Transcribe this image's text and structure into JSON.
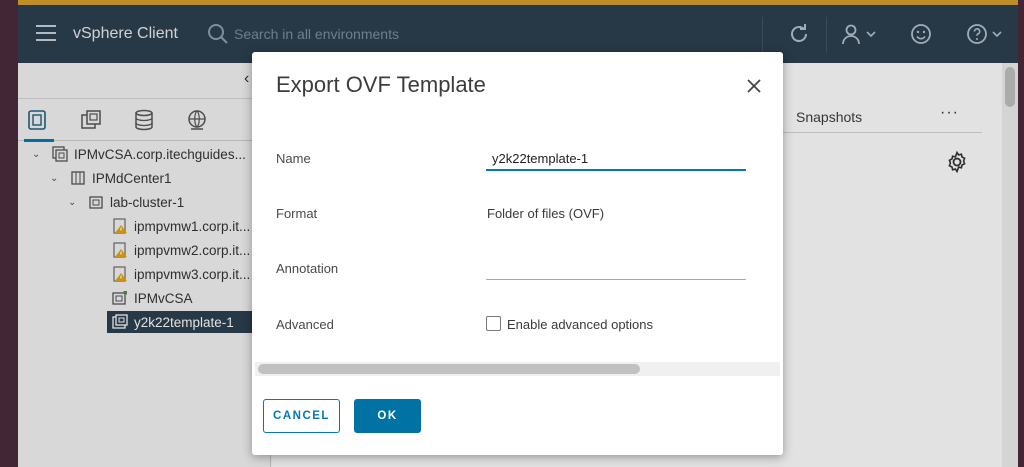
{
  "header": {
    "brand": "vSphere Client",
    "search_placeholder": "Search in all environments"
  },
  "tree": [
    {
      "label": "IPMvCSA.corp.itechguides...",
      "icon": "vcenter-icon",
      "expanded": true
    },
    {
      "label": "IPMdCenter1",
      "icon": "datacenter-icon",
      "expanded": true
    },
    {
      "label": "lab-cluster-1",
      "icon": "cluster-icon",
      "expanded": true
    },
    {
      "label": "ipmpvmw1.corp.it...",
      "icon": "host-warning-icon"
    },
    {
      "label": "ipmpvmw2.corp.it...",
      "icon": "host-warning-icon"
    },
    {
      "label": "ipmpvmw3.corp.it...",
      "icon": "host-warning-icon"
    },
    {
      "label": "IPMvCSA",
      "icon": "vm-icon"
    },
    {
      "label": "y2k22template-1",
      "icon": "template-icon",
      "selected": true
    }
  ],
  "content": {
    "tab_snapshots": "Snapshots",
    "more": "···"
  },
  "dialog": {
    "title": "Export OVF Template",
    "name_label": "Name",
    "name_value": "y2k22template-1",
    "format_label": "Format",
    "format_value": "Folder of files (OVF)",
    "annotation_label": "Annotation",
    "annotation_value": "",
    "advanced_label": "Advanced",
    "advanced_option": "Enable advanced options",
    "advanced_checked": false,
    "cancel_label": "CANCEL",
    "ok_label": "OK"
  },
  "colors": {
    "header_bg": "#2b3e4f",
    "accent": "#0079b8",
    "primary_button": "#0072a3",
    "selected_row": "#2b3e4f",
    "top_strip": "#d9a02a"
  }
}
